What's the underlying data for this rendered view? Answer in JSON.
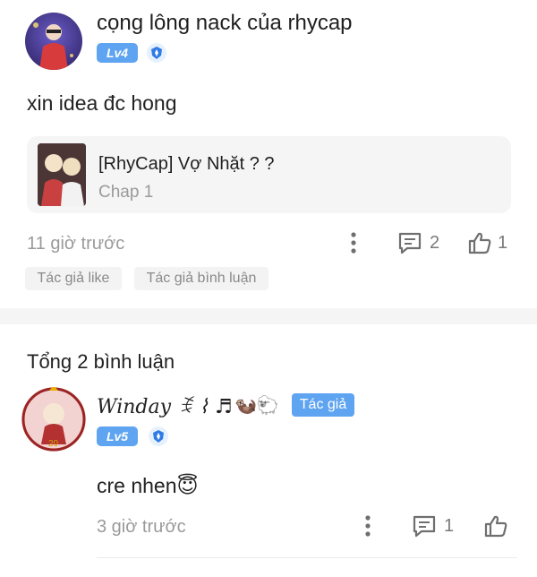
{
  "post": {
    "author_name": "cọng lông nack của rhycap",
    "level": "Lv4",
    "body": "xin idea đc hong",
    "card": {
      "title": "[RhyCap] Vợ Nhặt ? ?",
      "subtitle": "Chap 1"
    },
    "time": "11 giờ trước",
    "comment_count": "2",
    "like_count": "1",
    "tags": [
      "Tác giả like",
      "Tác giả bình luận"
    ]
  },
  "comments_header": "Tổng 2 bình luận",
  "comment": {
    "author_name": "Winday ꉂ ⌇ ♬",
    "author_emojis": "🦦🐑",
    "author_badge": "Tác giả",
    "level": "Lv5",
    "text": "cre nhen😇",
    "time": "3 giờ trước",
    "reply_count": "1"
  },
  "colors": {
    "accent": "#5fa4f1",
    "muted_text": "#9a9a9a",
    "divider": "#f5f5f5"
  }
}
